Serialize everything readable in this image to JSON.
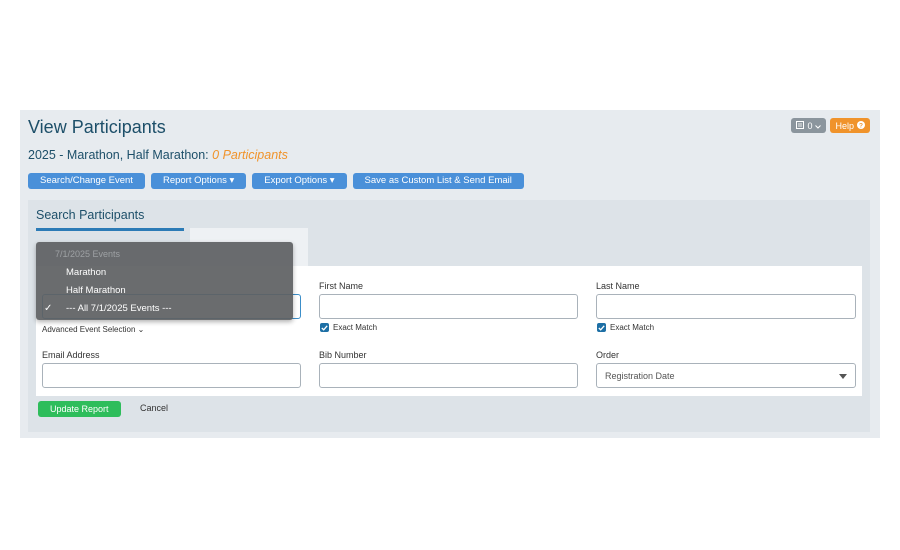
{
  "header": {
    "title": "View Participants",
    "count_badge": "0",
    "help_label": "Help"
  },
  "subtitle": {
    "event": "2025 - Marathon, Half Marathon:",
    "participants": "0 Participants"
  },
  "toolbar": {
    "search_change_event": "Search/Change Event",
    "report_options": "Report Options",
    "export_options": "Export Options",
    "save_custom_list": "Save as Custom List & Send Email"
  },
  "search": {
    "title": "Search Participants",
    "advanced_event_selection": "Advanced Event Selection",
    "first_name_label": "First Name",
    "last_name_label": "Last Name",
    "exact_match_label": "Exact Match",
    "email_label": "Email Address",
    "bib_label": "Bib Number",
    "order_label": "Order",
    "order_value": "Registration Date",
    "update_label": "Update Report",
    "cancel_label": "Cancel"
  },
  "event_dropdown": {
    "group_header": "7/1/2025 Events",
    "options": [
      "Marathon",
      "Half Marathon",
      "--- All 7/1/2025 Events ---"
    ],
    "selected_index": 2
  },
  "colors": {
    "title": "#1d4f69",
    "accent_orange": "#f0932b",
    "button_blue": "#4a90d9",
    "update_green": "#2ebd5b"
  }
}
